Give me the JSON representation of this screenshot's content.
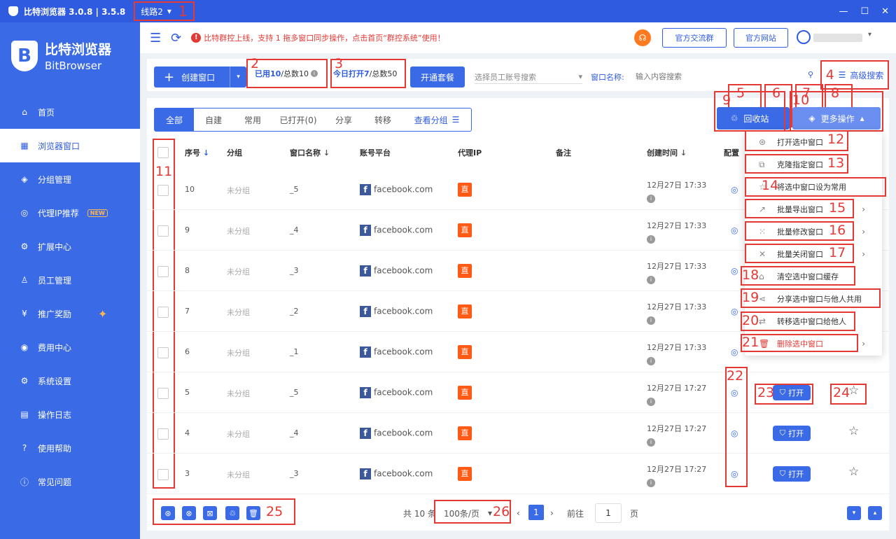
{
  "window": {
    "title": "比特浏览器 3.0.8 | 3.5.8",
    "line": "线路2",
    "line_caret": "▾",
    "minimize": "—",
    "maximize": "☐",
    "close": "✕"
  },
  "brand": {
    "logo_letter": "B",
    "name_cn": "比特浏览器",
    "name_en": "BitBrowser"
  },
  "nav": [
    {
      "icon": "⌂",
      "label": "首页"
    },
    {
      "icon": "▦",
      "label": "浏览器窗口"
    },
    {
      "icon": "◈",
      "label": "分组管理"
    },
    {
      "icon": "◎",
      "label": "代理IP推荐",
      "badge": "NEW"
    },
    {
      "icon": "⚙",
      "label": "扩展中心"
    },
    {
      "icon": "♙",
      "label": "员工管理"
    },
    {
      "icon": "¥",
      "label": "推广奖励",
      "sparkle": "✦"
    },
    {
      "icon": "◉",
      "label": "费用中心"
    },
    {
      "icon": "⚙",
      "label": "系统设置"
    },
    {
      "icon": "▤",
      "label": "操作日志"
    },
    {
      "icon": "?",
      "label": "使用帮助"
    },
    {
      "icon": "ⓘ",
      "label": "常见问题"
    }
  ],
  "topbar": {
    "menu_icon": "☰",
    "refresh_icon": "⟳",
    "notice_icon": "!",
    "notice": "比特群控上线，支持 1 拖多窗口同步操作，点击首页“群控系统”使用！",
    "headset_icon": "☊",
    "group_btn": "官方交流群",
    "site_btn": "官方网站",
    "user_caret": "▾"
  },
  "toolbar": {
    "create_label": "创建窗口",
    "create_icon": "+",
    "create_caret": "▾",
    "used_label": "已用10",
    "used_total": "/总数10",
    "info_icon": "i",
    "opened_label": "今日打开7",
    "opened_total": "/总数50",
    "plan_label": "开通套餐",
    "emp_placeholder": "选择员工账号搜索",
    "emp_caret": "▾",
    "name_label": "窗口名称:",
    "search_placeholder": "输入内容搜索",
    "search_icon": "⚲",
    "adv_icon": "☰",
    "adv_label": "高级搜索"
  },
  "tabs": [
    "全部",
    "自建",
    "常用",
    "已打开(0)",
    "分享",
    "转移",
    "查看分组"
  ],
  "tab_link_icon": "☰",
  "action_icons": {
    "save": "▣",
    "refresh": "⟳",
    "share": "⋖",
    "list": "☷",
    "recycle_icon": "♲"
  },
  "recycle_label": "回收站",
  "more_label": "更多操作",
  "more_icon": "◈",
  "more_caret": "▴",
  "columns": {
    "index": "序号",
    "group": "分组",
    "name": "窗口名称",
    "platform": "账号平台",
    "proxy": "代理IP",
    "remark": "备注",
    "created": "创建时间",
    "config": "配置",
    "sort_arrow": "↓"
  },
  "row_icons": {
    "fb": "f",
    "zhi": "直",
    "fp": "◎",
    "info": "i",
    "open_icon": "⛉",
    "open": "打开",
    "star": "☆"
  },
  "rows": [
    {
      "no": "10",
      "group": "未分组",
      "name": "_5",
      "platform": "facebook.com",
      "created": "12月27日 17:33"
    },
    {
      "no": "9",
      "group": "未分组",
      "name": "_4",
      "platform": "facebook.com",
      "created": "12月27日 17:33"
    },
    {
      "no": "8",
      "group": "未分组",
      "name": "_3",
      "platform": "facebook.com",
      "created": "12月27日 17:33"
    },
    {
      "no": "7",
      "group": "未分组",
      "name": "_2",
      "platform": "facebook.com",
      "created": "12月27日 17:33"
    },
    {
      "no": "6",
      "group": "未分组",
      "name": "_1",
      "platform": "facebook.com",
      "created": "12月27日 17:33"
    },
    {
      "no": "5",
      "group": "未分组",
      "name": "_5",
      "platform": "facebook.com",
      "created": "12月27日 17:27"
    },
    {
      "no": "4",
      "group": "未分组",
      "name": "_4",
      "platform": "facebook.com",
      "created": "12月27日 17:27"
    },
    {
      "no": "3",
      "group": "未分组",
      "name": "_3",
      "platform": "facebook.com",
      "created": "12月27日 17:27"
    }
  ],
  "dropdown": [
    {
      "icon": "⊛",
      "label": "打开选中窗口"
    },
    {
      "icon": "⧉",
      "label": "克隆指定窗口"
    },
    {
      "icon": "☆",
      "label": "将选中窗口设为常用"
    },
    {
      "icon": "↗",
      "label": "批量导出窗口",
      "arrow": "›"
    },
    {
      "icon": "⁙",
      "label": "批量修改窗口",
      "arrow": "›"
    },
    {
      "icon": "✕",
      "label": "批量关闭窗口",
      "arrow": "›"
    },
    {
      "icon": "⌂",
      "label": "清空选中窗口缓存"
    },
    {
      "icon": "⋖",
      "label": "分享选中窗口与他人共用"
    },
    {
      "icon": "⇄",
      "label": "转移选中窗口给他人"
    },
    {
      "icon": "🗑",
      "label": "删除选中窗口",
      "arrow": "›"
    }
  ],
  "footer": {
    "icons": [
      "⊛",
      "⊗",
      "⊠",
      "♲",
      "🗑"
    ],
    "total": "共 10 条",
    "page_size": "100条/页",
    "page_size_caret": "▾",
    "prev": "‹",
    "page": "1",
    "next": "›",
    "goto": "前往",
    "goto_value": "1",
    "page_word": "页",
    "scroll_down": "▾",
    "scroll_up": "▴"
  },
  "markers": [
    "1",
    "2",
    "3",
    "4",
    "5",
    "6",
    "7",
    "8",
    "9",
    "10",
    "11",
    "12",
    "13",
    "14",
    "15",
    "16",
    "17",
    "18",
    "19",
    "20",
    "21",
    "22",
    "23",
    "24",
    "25",
    "26"
  ]
}
